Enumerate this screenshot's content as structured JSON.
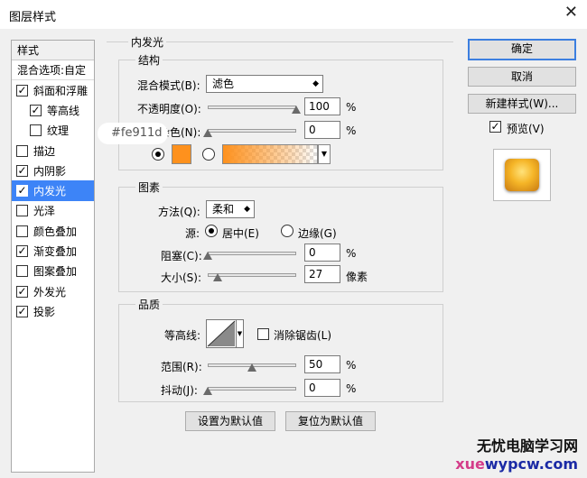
{
  "window": {
    "title": "图层样式",
    "close_icon": "close-icon"
  },
  "left_panel": {
    "header": "样式",
    "blend": "混合选项:自定",
    "items": [
      {
        "label": "斜面和浮雕",
        "checked": true,
        "sub": false,
        "selected": false
      },
      {
        "label": "等高线",
        "checked": true,
        "sub": true,
        "selected": false
      },
      {
        "label": "纹理",
        "checked": false,
        "sub": true,
        "selected": false
      },
      {
        "label": "描边",
        "checked": false,
        "sub": false,
        "selected": false
      },
      {
        "label": "内阴影",
        "checked": true,
        "sub": false,
        "selected": false
      },
      {
        "label": "内发光",
        "checked": true,
        "sub": false,
        "selected": true
      },
      {
        "label": "光泽",
        "checked": false,
        "sub": false,
        "selected": false
      },
      {
        "label": "颜色叠加",
        "checked": false,
        "sub": false,
        "selected": false
      },
      {
        "label": "渐变叠加",
        "checked": true,
        "sub": false,
        "selected": false
      },
      {
        "label": "图案叠加",
        "checked": false,
        "sub": false,
        "selected": false
      },
      {
        "label": "外发光",
        "checked": true,
        "sub": false,
        "selected": false
      },
      {
        "label": "投影",
        "checked": true,
        "sub": false,
        "selected": false
      }
    ]
  },
  "inner_glow": {
    "title": "内发光",
    "structure": {
      "title": "结构",
      "blend_mode_label": "混合模式(B):",
      "blend_mode_value": "滤色",
      "opacity_label": "不透明度(O):",
      "opacity_value": "100",
      "opacity_level": 100,
      "noise_label": "杂色(N):",
      "noise_value": "0",
      "noise_level": 0,
      "percent": "%",
      "color_hex": "#fe911d",
      "color_tooltip": "#fe911d"
    },
    "elements": {
      "title": "图素",
      "technique_label": "方法(Q):",
      "technique_value": "柔和",
      "source_label": "源:",
      "source_center": "居中(E)",
      "source_edge": "边缘(G)",
      "choke_label": "阻塞(C):",
      "choke_value": "0",
      "choke_level": 0,
      "size_label": "大小(S):",
      "size_value": "27",
      "size_level": 11,
      "size_unit": "像素",
      "percent": "%"
    },
    "quality": {
      "title": "品质",
      "contour_label": "等高线:",
      "anti_alias_label": "消除锯齿(L)",
      "range_label": "范围(R):",
      "range_value": "50",
      "range_level": 50,
      "jitter_label": "抖动(J):",
      "jitter_value": "0",
      "jitter_level": 0,
      "percent": "%"
    },
    "make_default": "设置为默认值",
    "reset_default": "复位为默认值"
  },
  "right_panel": {
    "ok": "确定",
    "cancel": "取消",
    "new_style": "新建样式(W)...",
    "preview_label": "预览(V)",
    "preview_checked": true
  },
  "watermark": {
    "line1": "无忧电脑学习网",
    "line2_a": "xue",
    "line2_b": "wypcw.com"
  }
}
